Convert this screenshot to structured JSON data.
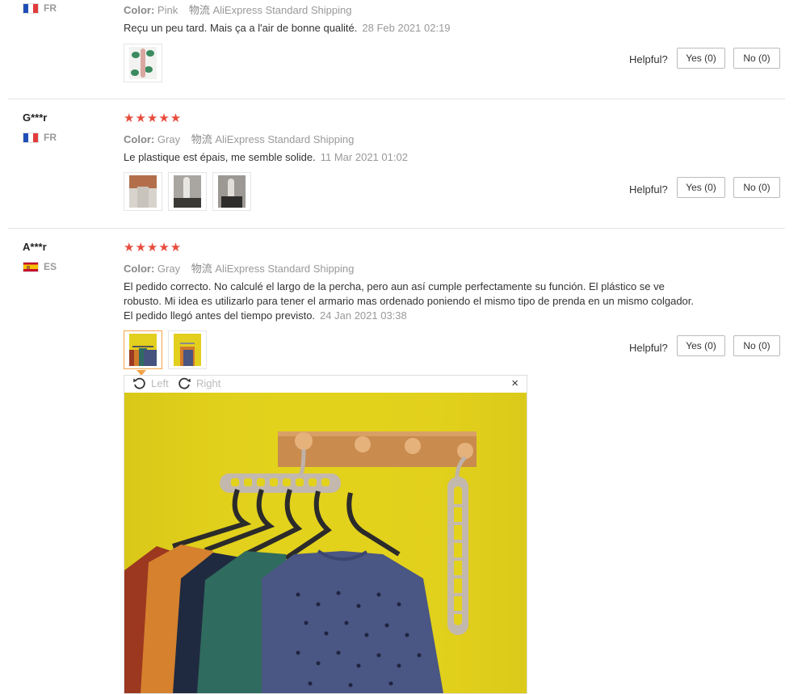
{
  "reviews": [
    {
      "user": "",
      "country": "FR",
      "color_label": "Color:",
      "color_value": "Pink",
      "shipping_label": "物流",
      "shipping_value": "AliExpress Standard Shipping",
      "text": "Reçu un peu tard. Mais ça a l'air de bonne qualité.",
      "date": "28 Feb 2021 02:19",
      "helpful": "Helpful?",
      "yes": "Yes (0)",
      "no": "No (0)"
    },
    {
      "user": "G***r",
      "country": "FR",
      "stars": "★★★★★",
      "color_label": "Color:",
      "color_value": "Gray",
      "shipping_label": "物流",
      "shipping_value": "AliExpress Standard Shipping",
      "text": "Le plastique est épais, me semble solide.",
      "date": "11 Mar 2021 01:02",
      "helpful": "Helpful?",
      "yes": "Yes (0)",
      "no": "No (0)"
    },
    {
      "user": "A***r",
      "country": "ES",
      "stars": "★★★★★",
      "color_label": "Color:",
      "color_value": "Gray",
      "shipping_label": "物流",
      "shipping_value": "AliExpress Standard Shipping",
      "text": "El pedido correcto. No calculé el largo de la percha, pero aun así cumple perfectamente su función. El plástico se ve robusto. Mi idea es utilizarlo para tener el armario mas ordenado poniendo el mismo tipo de prenda en un mismo colgador. El pedido llegó antes del tiempo previsto.",
      "date": "24 Jan 2021 03:38",
      "helpful": "Helpful?",
      "yes": "Yes (0)",
      "no": "No (0)"
    }
  ],
  "viewer": {
    "rotate_left": "Left",
    "rotate_right": "Right",
    "close": "×"
  },
  "colors": {
    "star": "#e84c3d",
    "active_border": "#f3a347",
    "wall": "#e3d21c"
  }
}
